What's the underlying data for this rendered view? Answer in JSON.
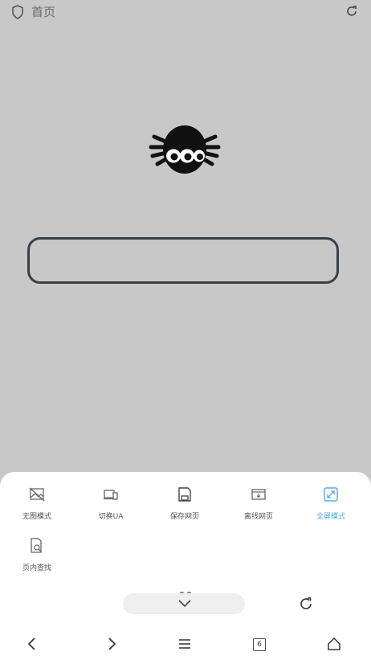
{
  "topbar": {
    "home_label": "首页"
  },
  "menu": {
    "items": [
      {
        "label": "无图模式",
        "icon": "no-image-icon",
        "active": false
      },
      {
        "label": "切换UA",
        "icon": "devices-icon",
        "active": false
      },
      {
        "label": "保存网页",
        "icon": "save-page-icon",
        "active": false
      },
      {
        "label": "离线网页",
        "icon": "offline-page-icon",
        "active": false
      },
      {
        "label": "全屏模式",
        "icon": "fullscreen-icon",
        "active": true
      },
      {
        "label": "页内查找",
        "icon": "find-in-page-icon",
        "active": false
      }
    ]
  },
  "nav": {
    "tab_count": "6"
  },
  "colors": {
    "background": "#c8c8c8",
    "sheet": "#ffffff",
    "accent": "#5aa7e6"
  }
}
